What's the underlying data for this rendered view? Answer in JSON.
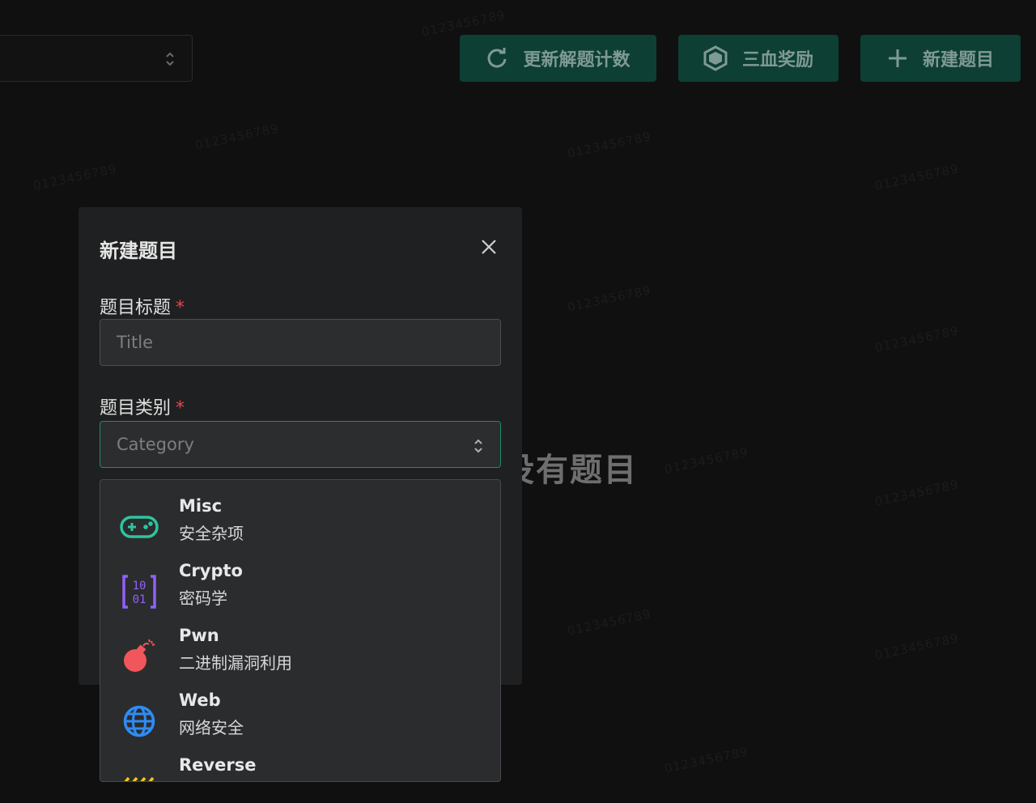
{
  "toolbar": {
    "refresh_label": "更新解题计数",
    "blood_label": "三血奖励",
    "new_label": "新建题目"
  },
  "main": {
    "empty_text": "没有题目"
  },
  "modal": {
    "title": "新建题目",
    "title_field": {
      "label": "题目标题",
      "required_mark": "*",
      "placeholder": "Title",
      "value": ""
    },
    "category_field": {
      "label": "题目类别",
      "required_mark": "*",
      "placeholder": "Category"
    }
  },
  "categories": [
    {
      "name": "Misc",
      "desc": "安全杂项",
      "icon": "gamepad-icon",
      "color": "#2ec4a0"
    },
    {
      "name": "Crypto",
      "desc": "密码学",
      "icon": "binary-icon",
      "color": "#9061f9"
    },
    {
      "name": "Pwn",
      "desc": "二进制漏洞利用",
      "icon": "bomb-icon",
      "color": "#f0565b"
    },
    {
      "name": "Web",
      "desc": "网络安全",
      "icon": "globe-icon",
      "color": "#2f8cf4"
    },
    {
      "name": "Reverse",
      "desc": "",
      "icon": "stripes-icon",
      "color": "#f5c518"
    }
  ],
  "colors": {
    "accent": "#1c8c70",
    "button_bg": "#0d3f34",
    "danger": "#e5484d"
  }
}
